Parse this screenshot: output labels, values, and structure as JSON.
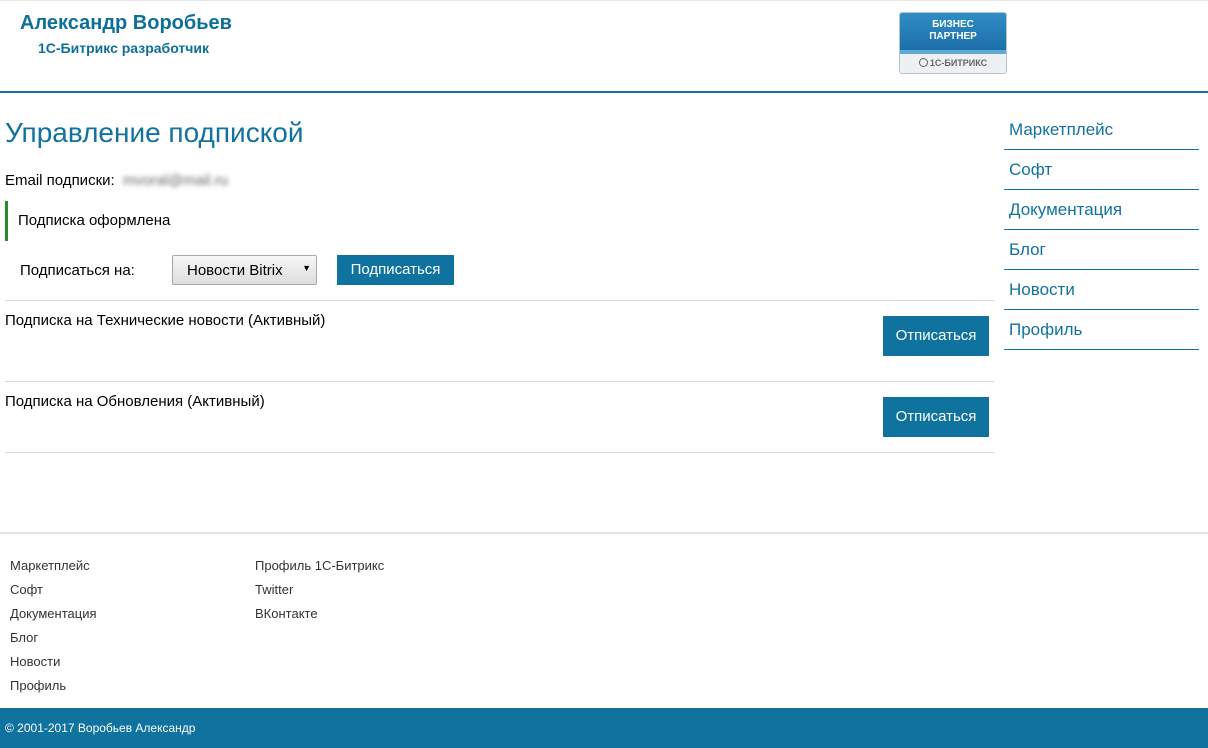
{
  "header": {
    "site_name": "Александр Воробьев",
    "site_sub": "1С-Битрикс разработчик",
    "badge": {
      "line1": "БИЗНЕС",
      "line2": "ПАРТНЕР",
      "brand": "1С-БИТРИКС"
    }
  },
  "main": {
    "title": "Управление подпиской",
    "email_label": "Email подписки:",
    "email_value": "mvoral@mail.ru",
    "notice": "Подписка оформлена",
    "subscribe_label": "Подписаться на:",
    "select_value": "Новости Bitrix",
    "subscribe_button": "Подписаться",
    "subscriptions": [
      {
        "text": "Подписка на Технические новости (Активный)",
        "button": "Отписаться"
      },
      {
        "text": "Подписка на Обновления (Активный)",
        "button": "Отписаться"
      }
    ]
  },
  "right_nav": [
    "Маркетплейс",
    "Софт",
    "Документация",
    "Блог",
    "Новости",
    "Профиль"
  ],
  "footer": {
    "col1": [
      "Маркетплейс",
      "Софт",
      "Документация",
      "Блог",
      "Новости",
      "Профиль"
    ],
    "col2": [
      "Профиль 1С-Битрикс",
      "Twitter",
      "ВКонтакте"
    ],
    "copyright": "© 2001-2017 Воробьев Александр"
  },
  "colors": {
    "accent": "#10729e",
    "notice_border": "#2b8a2b"
  }
}
